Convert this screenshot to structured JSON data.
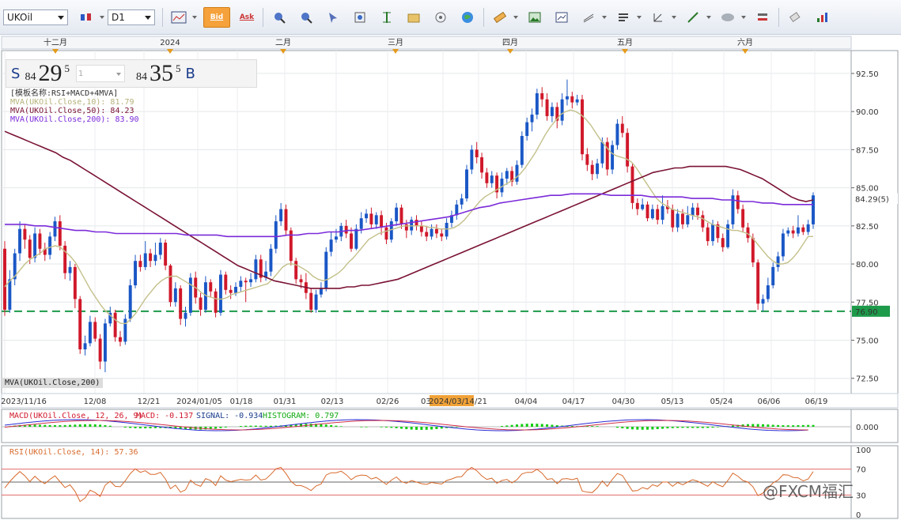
{
  "toolbar": {
    "symbol": "UKOil",
    "timeframe": "D1",
    "bid_label": "Bid",
    "ask_label": "Ask",
    "icons": [
      "candle-type-icon",
      "line-chart-icon",
      "zoom-in-icon",
      "zoom-out-icon",
      "cursor-icon",
      "fit-icon",
      "vertical-fit-icon",
      "folder-icon",
      "indicator-icon",
      "globe-icon",
      "ruler-icon",
      "picture-icon",
      "snapshot-icon",
      "draw-lines-icon",
      "bars-icon",
      "arrow-icon",
      "trend-line-icon",
      "ellipse-icon",
      "settings-icon",
      "eraser-icon",
      "grid-icon"
    ]
  },
  "quote": {
    "sell_letter": "S",
    "sell_prefix": "84",
    "sell_big": "29",
    "sell_pip": "5",
    "amount_value": "1",
    "buy_prefix": "84",
    "buy_big": "35",
    "buy_pip": "5",
    "buy_letter": "B"
  },
  "legend": {
    "template": "[模板名称:RSI+MACD+4MVA]",
    "mva10": "MVA(UKOil.Close,10): 81.79",
    "mva50": "MVA(UKOil.Close,50): 84.23",
    "mva200": "MVA(UKOil.Close,200): 83.90",
    "mva_tag": "MVA(UKOil.Close,200)"
  },
  "macd_legend": {
    "macd": "MACD(UKOil.Close, 12, 26, 9)",
    "macd_val": "MACD: -0.137",
    "signal": "SIGNAL: -0.934",
    "histogram": "HISTOGRAM: 0.797"
  },
  "rsi_legend": "RSI(UKOil.Close, 14): 57.36",
  "watermark": "@FXCM福汇",
  "colors": {
    "up": "#1a57c6",
    "down": "#d0182a",
    "mva10": "#c3c08a",
    "mva50": "#7a1233",
    "mva200": "#7b2bd9",
    "support": "#1d9a4a",
    "macd_line": "#2a2ad4",
    "signal_line": "#d0304a",
    "hist": "#11cc11",
    "rsi": "#d86a2c"
  },
  "chart_data": {
    "type": "candlestick",
    "y_axis": {
      "ticks": [
        "92.50",
        "90.00",
        "87.50",
        "85.00",
        "82.50",
        "80.00",
        "77.50",
        "75.00",
        "72.50"
      ],
      "range": [
        71.5,
        94.0
      ]
    },
    "top_axis_labels": [
      "十二月",
      "2024",
      "二月",
      "三月",
      "四月",
      "五月",
      "六月"
    ],
    "bottom_axis_labels": [
      "2023/11/16",
      "12/08",
      "12/21",
      "2024/01/05",
      "01/18",
      "01/31",
      "02/13",
      "02/26",
      "03/",
      "2024/03/14",
      "/21",
      "04/04",
      "04/17",
      "04/30",
      "05/13",
      "05/24",
      "06/06",
      "06/19"
    ],
    "last_price_label": "84.29(5)",
    "support_label": "76.90",
    "support_level": 76.9,
    "candles": [
      [
        81.0,
        77.0,
        81.5,
        76.6
      ],
      [
        77.0,
        79.0,
        79.6,
        76.8
      ],
      [
        79.0,
        80.7,
        81.0,
        78.6
      ],
      [
        80.7,
        82.3,
        82.8,
        80.2
      ],
      [
        82.3,
        81.6,
        82.6,
        81.0
      ],
      [
        81.6,
        80.4,
        81.9,
        80.0
      ],
      [
        80.4,
        82.0,
        82.4,
        80.1
      ],
      [
        82.0,
        81.0,
        82.3,
        80.6
      ],
      [
        81.0,
        80.6,
        81.4,
        80.2
      ],
      [
        80.6,
        81.8,
        82.1,
        80.3
      ],
      [
        81.8,
        82.8,
        83.1,
        81.5
      ],
      [
        82.8,
        81.2,
        83.2,
        80.9
      ],
      [
        81.2,
        79.4,
        81.5,
        79.0
      ],
      [
        79.4,
        79.8,
        80.2,
        78.9
      ],
      [
        79.8,
        77.7,
        80.0,
        77.1
      ],
      [
        77.7,
        74.4,
        77.9,
        74.1
      ],
      [
        74.4,
        74.8,
        75.3,
        74.0
      ],
      [
        74.8,
        76.2,
        76.6,
        74.6
      ],
      [
        76.2,
        75.1,
        76.5,
        74.9
      ],
      [
        75.1,
        73.6,
        75.4,
        73.1
      ],
      [
        73.6,
        76.1,
        76.4,
        72.9
      ],
      [
        76.1,
        76.8,
        77.2,
        75.9
      ],
      [
        76.8,
        75.2,
        77.0,
        74.9
      ],
      [
        75.2,
        74.9,
        75.6,
        74.6
      ],
      [
        74.9,
        76.4,
        76.7,
        74.7
      ],
      [
        76.4,
        78.6,
        79.0,
        76.2
      ],
      [
        78.6,
        80.2,
        80.6,
        78.4
      ],
      [
        80.2,
        79.8,
        80.6,
        79.5
      ],
      [
        79.8,
        80.7,
        81.5,
        79.6
      ],
      [
        80.7,
        80.2,
        81.0,
        79.8
      ],
      [
        80.2,
        80.6,
        81.4,
        79.9
      ],
      [
        80.6,
        81.4,
        81.7,
        80.3
      ],
      [
        81.4,
        79.9,
        81.6,
        79.6
      ],
      [
        79.9,
        77.5,
        80.0,
        77.2
      ],
      [
        77.5,
        78.4,
        78.8,
        77.2
      ],
      [
        78.4,
        76.4,
        78.6,
        76.0
      ],
      [
        76.4,
        76.8,
        77.2,
        75.9
      ],
      [
        76.8,
        79.1,
        79.4,
        76.6
      ],
      [
        79.1,
        77.8,
        79.5,
        77.4
      ],
      [
        77.8,
        77.0,
        78.1,
        76.6
      ],
      [
        77.0,
        78.8,
        79.2,
        76.8
      ],
      [
        78.8,
        78.2,
        79.0,
        77.8
      ],
      [
        78.2,
        76.8,
        78.4,
        76.5
      ],
      [
        76.8,
        79.3,
        79.6,
        76.6
      ],
      [
        79.3,
        78.3,
        79.5,
        78.0
      ],
      [
        78.3,
        78.1,
        78.6,
        77.7
      ],
      [
        78.1,
        78.5,
        78.8,
        77.9
      ],
      [
        78.5,
        78.9,
        79.2,
        78.2
      ],
      [
        78.9,
        78.8,
        79.1,
        77.5
      ],
      [
        78.8,
        79.0,
        79.4,
        78.5
      ],
      [
        79.0,
        80.3,
        80.6,
        78.8
      ],
      [
        80.3,
        79.1,
        80.6,
        78.8
      ],
      [
        79.1,
        79.5,
        80.2,
        78.9
      ],
      [
        79.5,
        81.0,
        81.3,
        79.2
      ],
      [
        81.0,
        82.8,
        83.2,
        80.7
      ],
      [
        82.8,
        83.6,
        84.0,
        82.5
      ],
      [
        83.6,
        82.2,
        83.9,
        81.9
      ],
      [
        82.2,
        80.2,
        82.4,
        79.9
      ],
      [
        80.2,
        79.0,
        80.4,
        78.7
      ],
      [
        79.0,
        78.8,
        79.3,
        78.4
      ],
      [
        78.8,
        78.1,
        79.4,
        77.7
      ],
      [
        78.1,
        77.0,
        78.4,
        76.8
      ],
      [
        77.0,
        78.0,
        78.3,
        76.8
      ],
      [
        78.0,
        78.4,
        78.8,
        77.8
      ],
      [
        78.4,
        80.8,
        81.1,
        78.2
      ],
      [
        80.8,
        81.6,
        82.1,
        80.5
      ],
      [
        81.6,
        81.8,
        82.3,
        81.4
      ],
      [
        81.8,
        82.5,
        82.7,
        81.5
      ],
      [
        82.5,
        82.0,
        82.9,
        81.7
      ],
      [
        82.0,
        81.0,
        82.4,
        80.8
      ],
      [
        81.0,
        82.3,
        82.6,
        80.9
      ],
      [
        82.3,
        83.0,
        83.4,
        82.0
      ],
      [
        83.0,
        83.3,
        83.6,
        82.7
      ],
      [
        83.3,
        82.6,
        83.7,
        82.3
      ],
      [
        82.6,
        83.2,
        83.4,
        82.3
      ],
      [
        83.2,
        82.4,
        83.5,
        81.9
      ],
      [
        82.4,
        81.6,
        82.7,
        81.3
      ],
      [
        81.6,
        82.8,
        83.0,
        81.4
      ],
      [
        82.8,
        83.7,
        84.0,
        82.5
      ],
      [
        83.7,
        82.6,
        83.9,
        82.3
      ],
      [
        82.6,
        82.2,
        82.9,
        81.7
      ],
      [
        82.2,
        82.9,
        83.1,
        81.9
      ],
      [
        82.9,
        82.5,
        83.2,
        82.2
      ],
      [
        82.5,
        82.1,
        82.8,
        81.8
      ],
      [
        82.1,
        81.8,
        82.5,
        81.5
      ],
      [
        81.8,
        82.3,
        82.6,
        81.6
      ],
      [
        82.3,
        82.0,
        82.6,
        81.7
      ],
      [
        82.0,
        81.8,
        82.3,
        81.5
      ],
      [
        81.8,
        82.7,
        83.0,
        81.6
      ],
      [
        82.7,
        83.2,
        83.5,
        82.4
      ],
      [
        83.2,
        83.9,
        84.2,
        82.9
      ],
      [
        83.9,
        84.3,
        84.6,
        83.6
      ],
      [
        84.3,
        86.2,
        86.5,
        84.1
      ],
      [
        86.2,
        87.5,
        87.8,
        85.9
      ],
      [
        87.5,
        87.0,
        88.0,
        86.6
      ],
      [
        87.0,
        86.0,
        87.3,
        85.6
      ],
      [
        86.0,
        85.3,
        86.3,
        85.0
      ],
      [
        85.3,
        85.8,
        86.1,
        85.0
      ],
      [
        85.8,
        84.7,
        86.0,
        84.3
      ],
      [
        84.7,
        85.6,
        86.0,
        84.4
      ],
      [
        85.6,
        86.1,
        86.3,
        85.2
      ],
      [
        86.1,
        85.4,
        86.4,
        85.1
      ],
      [
        85.4,
        86.5,
        86.8,
        85.2
      ],
      [
        86.5,
        88.4,
        88.7,
        86.3
      ],
      [
        88.4,
        89.3,
        89.6,
        88.1
      ],
      [
        89.3,
        89.8,
        90.2,
        88.7
      ],
      [
        89.8,
        91.2,
        91.5,
        89.5
      ],
      [
        91.2,
        90.8,
        91.6,
        90.3
      ],
      [
        90.8,
        89.7,
        91.2,
        89.4
      ],
      [
        89.7,
        90.3,
        90.6,
        89.3
      ],
      [
        90.3,
        89.4,
        90.6,
        88.9
      ],
      [
        89.4,
        90.8,
        91.2,
        89.1
      ],
      [
        90.8,
        91.0,
        92.1,
        90.4
      ],
      [
        91.0,
        90.6,
        91.3,
        90.2
      ],
      [
        90.6,
        90.8,
        91.1,
        90.4
      ],
      [
        90.8,
        87.2,
        91.1,
        86.8
      ],
      [
        87.2,
        86.5,
        87.6,
        86.1
      ],
      [
        86.5,
        85.9,
        86.8,
        85.5
      ],
      [
        85.9,
        86.6,
        86.9,
        85.6
      ],
      [
        86.6,
        88.0,
        88.3,
        86.3
      ],
      [
        88.0,
        86.2,
        88.3,
        85.8
      ],
      [
        86.2,
        87.8,
        88.1,
        85.9
      ],
      [
        87.8,
        89.2,
        89.5,
        87.5
      ],
      [
        89.2,
        88.6,
        89.7,
        88.3
      ],
      [
        88.6,
        86.4,
        88.9,
        86.0
      ],
      [
        86.4,
        84.0,
        86.6,
        83.6
      ],
      [
        84.0,
        83.6,
        84.3,
        83.2
      ],
      [
        83.6,
        83.9,
        84.3,
        83.5
      ],
      [
        83.9,
        83.0,
        84.1,
        82.8
      ],
      [
        83.0,
        83.6,
        83.9,
        82.9
      ],
      [
        83.6,
        82.9,
        83.9,
        82.6
      ],
      [
        82.9,
        83.8,
        84.5,
        82.6
      ],
      [
        83.8,
        83.6,
        84.2,
        83.3
      ],
      [
        83.6,
        82.4,
        83.9,
        82.1
      ],
      [
        82.4,
        83.3,
        83.6,
        82.1
      ],
      [
        83.3,
        82.6,
        83.6,
        82.3
      ],
      [
        82.6,
        83.2,
        83.8,
        82.4
      ],
      [
        83.2,
        83.7,
        84.0,
        82.9
      ],
      [
        83.7,
        83.2,
        84.0,
        82.9
      ],
      [
        83.2,
        82.4,
        83.5,
        82.1
      ],
      [
        82.4,
        81.5,
        82.7,
        81.2
      ],
      [
        81.5,
        82.6,
        82.9,
        81.2
      ],
      [
        82.6,
        81.7,
        82.8,
        81.4
      ],
      [
        81.7,
        81.1,
        82.0,
        80.8
      ],
      [
        81.1,
        82.6,
        82.9,
        81.0
      ],
      [
        82.6,
        84.5,
        84.9,
        82.3
      ],
      [
        84.5,
        83.6,
        84.8,
        83.3
      ],
      [
        83.6,
        82.4,
        83.9,
        82.1
      ],
      [
        82.4,
        81.7,
        82.7,
        81.4
      ],
      [
        81.7,
        80.1,
        82.0,
        79.8
      ],
      [
        80.1,
        77.4,
        80.3,
        77.0
      ],
      [
        77.4,
        77.7,
        78.0,
        76.9
      ],
      [
        77.7,
        78.6,
        79.1,
        77.5
      ],
      [
        78.6,
        79.8,
        80.1,
        78.4
      ],
      [
        79.8,
        80.5,
        80.8,
        79.5
      ],
      [
        80.5,
        82.0,
        82.3,
        80.2
      ],
      [
        82.0,
        82.2,
        82.4,
        81.8
      ],
      [
        82.2,
        82.0,
        82.5,
        81.7
      ],
      [
        82.0,
        82.4,
        83.2,
        81.8
      ],
      [
        82.4,
        82.1,
        82.6,
        81.9
      ],
      [
        82.1,
        82.6,
        82.9,
        81.9
      ],
      [
        82.6,
        84.5,
        84.7,
        82.3
      ]
    ],
    "mva10": [
      78.5,
      78.9,
      79.2,
      79.6,
      80.0,
      80.3,
      80.5,
      80.7,
      81.0,
      81.1,
      81.2,
      81.1,
      80.8,
      80.5,
      80.1,
      79.5,
      78.9,
      78.3,
      77.8,
      77.3,
      76.9,
      76.6,
      76.3,
      76.1,
      76.1,
      76.4,
      76.8,
      77.3,
      77.8,
      78.2,
      78.6,
      78.9,
      79.1,
      79.2,
      79.2,
      79.0,
      78.8,
      78.6,
      78.4,
      78.1,
      77.9,
      77.8,
      77.7,
      77.7,
      77.8,
      78.0,
      78.1,
      78.2,
      78.3,
      78.4,
      78.5,
      78.6,
      78.7,
      79.0,
      79.4,
      79.8,
      80.0,
      80.0,
      79.9,
      79.7,
      79.5,
      79.2,
      79.0,
      78.9,
      79.0,
      79.2,
      79.4,
      79.7,
      80.1,
      80.4,
      80.8,
      81.2,
      81.6,
      81.8,
      82.0,
      82.1,
      82.2,
      82.3,
      82.4,
      82.5,
      82.5,
      82.5,
      82.5,
      82.5,
      82.4,
      82.4,
      82.3,
      82.3,
      82.3,
      82.4,
      82.6,
      82.9,
      83.3,
      83.7,
      84.1,
      84.4,
      84.6,
      84.8,
      85.0,
      85.2,
      85.4,
      85.6,
      85.9,
      86.3,
      86.8,
      87.3,
      87.9,
      88.5,
      89.0,
      89.4,
      89.8,
      90.0,
      90.1,
      90.0,
      89.8,
      89.5,
      89.1,
      88.6,
      88.1,
      87.7,
      87.3,
      87.1,
      87.0,
      86.9,
      86.7,
      86.3,
      85.8,
      85.3,
      84.8,
      84.3,
      84.0,
      83.8,
      83.6,
      83.5,
      83.4,
      83.3,
      83.2,
      83.1,
      83.0,
      82.8,
      82.6,
      82.5,
      82.4,
      82.3,
      82.2,
      82.2,
      82.1,
      82.0,
      81.7,
      81.3,
      80.9,
      80.5,
      80.2,
      80.0,
      80.0,
      80.1,
      80.4,
      80.8,
      81.3,
      81.8,
      81.8
    ],
    "mva50": [
      88.7,
      88.5,
      88.3,
      88.1,
      87.9,
      87.7,
      87.5,
      87.3,
      87.0,
      86.8,
      86.5,
      86.2,
      85.9,
      85.6,
      85.3,
      85.0,
      84.7,
      84.4,
      84.1,
      83.8,
      83.5,
      83.2,
      82.9,
      82.6,
      82.3,
      82.0,
      81.7,
      81.4,
      81.1,
      80.8,
      80.5,
      80.2,
      79.9,
      79.7,
      79.5,
      79.3,
      79.1,
      78.9,
      78.8,
      78.7,
      78.6,
      78.5,
      78.4,
      78.4,
      78.4,
      78.4,
      78.4,
      78.5,
      78.5,
      78.6,
      78.6,
      78.7,
      78.8,
      78.9,
      79.0,
      79.2,
      79.4,
      79.6,
      79.8,
      80.0,
      80.2,
      80.4,
      80.6,
      80.8,
      81.0,
      81.2,
      81.4,
      81.6,
      81.8,
      82.0,
      82.2,
      82.4,
      82.6,
      82.8,
      83.0,
      83.2,
      83.4,
      83.6,
      83.8,
      84.0,
      84.2,
      84.4,
      84.6,
      84.8,
      85.0,
      85.2,
      85.4,
      85.6,
      85.8,
      86.0,
      86.1,
      86.2,
      86.3,
      86.3,
      86.4,
      86.4,
      86.4,
      86.4,
      86.4,
      86.4,
      86.3,
      86.2,
      86.0,
      85.8,
      85.6,
      85.3,
      85.0,
      84.7,
      84.4,
      84.2,
      84.1,
      84.2
    ],
    "mva200": [
      82.6,
      82.6,
      82.6,
      82.5,
      82.5,
      82.4,
      82.3,
      82.2,
      82.2,
      82.1,
      82.1,
      82.0,
      82.0,
      82.0,
      82.0,
      82.0,
      82.0,
      82.0,
      81.9,
      81.9,
      81.9,
      81.9,
      81.8,
      81.8,
      81.8,
      81.8,
      81.8,
      81.8,
      81.9,
      81.9,
      82.0,
      82.0,
      82.1,
      82.1,
      82.2,
      82.2,
      82.3,
      82.4,
      82.5,
      82.6,
      82.7,
      82.8,
      82.9,
      83.0,
      83.1,
      83.3,
      83.5,
      83.7,
      83.8,
      84.0,
      84.1,
      84.2,
      84.3,
      84.4,
      84.5,
      84.5,
      84.6,
      84.6,
      84.6,
      84.6,
      84.5,
      84.5,
      84.5,
      84.5,
      84.4,
      84.4,
      84.4,
      84.4,
      84.3,
      84.3,
      84.3,
      84.2,
      84.2,
      84.1,
      84.1,
      84.0,
      84.0,
      83.9,
      83.9,
      83.9,
      83.9
    ],
    "rsi_axis": {
      "ticks": [
        "100",
        "70",
        "30",
        "0"
      ],
      "range": [
        0,
        100
      ]
    },
    "macd_axis": {
      "ticks": [
        "0.000"
      ]
    }
  }
}
